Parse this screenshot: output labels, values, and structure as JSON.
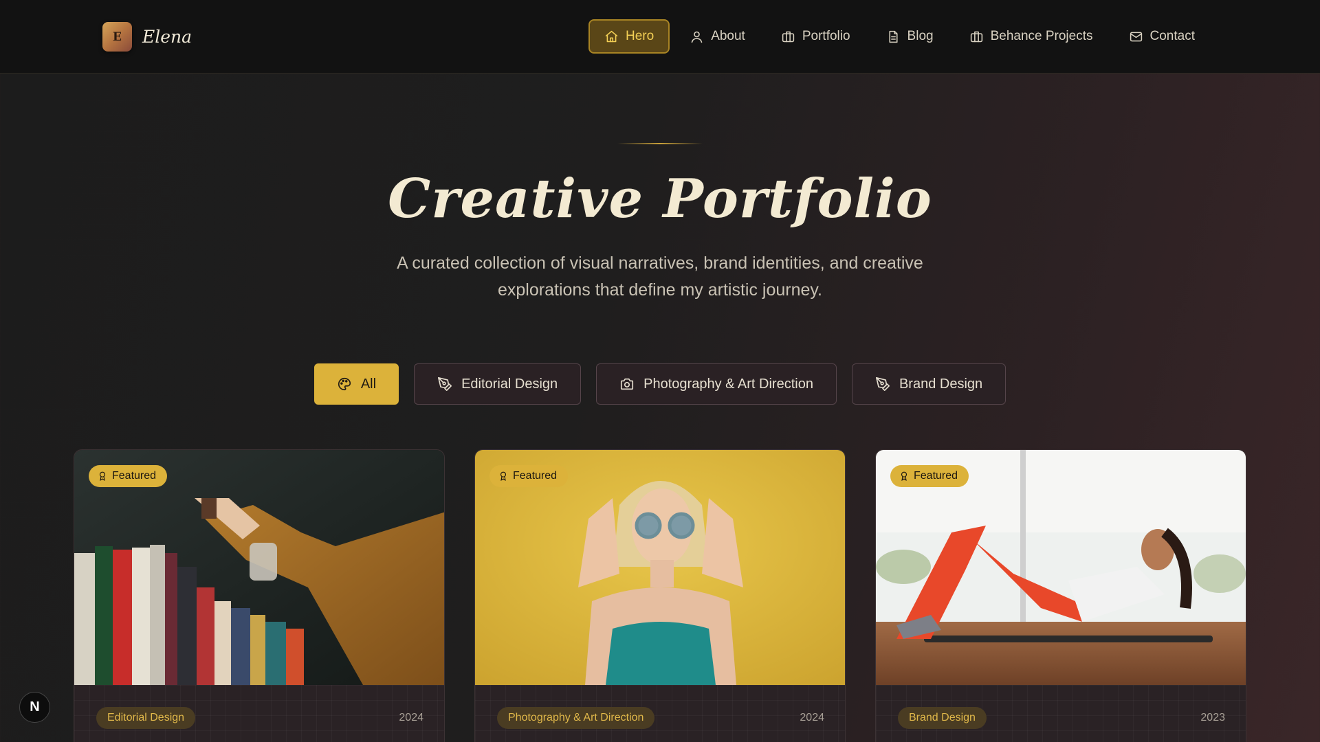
{
  "brand": {
    "initial": "E",
    "name": "Elena"
  },
  "nav": {
    "items": [
      {
        "label": "Hero",
        "icon": "home-icon",
        "active": true
      },
      {
        "label": "About",
        "icon": "user-icon"
      },
      {
        "label": "Portfolio",
        "icon": "briefcase-icon"
      },
      {
        "label": "Blog",
        "icon": "document-icon"
      },
      {
        "label": "Behance Projects",
        "icon": "briefcase-icon"
      },
      {
        "label": "Contact",
        "icon": "mail-icon"
      }
    ]
  },
  "hero": {
    "title": "Creative Portfolio",
    "subtitle": "A curated collection of visual narratives, brand identities, and creative explorations that define my artistic journey."
  },
  "filters": [
    {
      "label": "All",
      "icon": "palette-icon",
      "active": true
    },
    {
      "label": "Editorial Design",
      "icon": "pen-tool-icon"
    },
    {
      "label": "Photography & Art Direction",
      "icon": "camera-icon"
    },
    {
      "label": "Brand Design",
      "icon": "pen-tool-icon"
    }
  ],
  "cards": [
    {
      "badge": "Featured",
      "category": "Editorial Design",
      "year": "2024",
      "image": "hand-reaching-bookshelf-photo"
    },
    {
      "badge": "Featured",
      "category": "Photography & Art Direction",
      "year": "2024",
      "image": "woman-sunglasses-yellow-wall-photo"
    },
    {
      "badge": "Featured",
      "category": "Brand Design",
      "year": "2023",
      "image": "woman-doing-situps-photo"
    }
  ],
  "colors": {
    "accent": "#dcb23a",
    "background": "#1c1c1c",
    "nav_bg": "#121212"
  },
  "floating": {
    "label": "N"
  }
}
